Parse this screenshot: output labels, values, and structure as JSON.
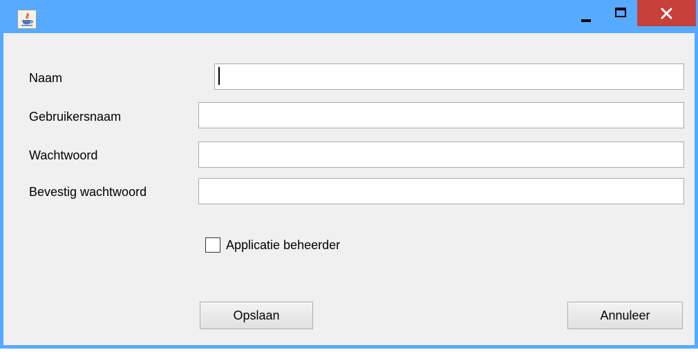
{
  "window": {
    "icon": "java-app-icon",
    "controls": {
      "minimize": "minimize-icon",
      "maximize": "maximize-icon",
      "close": "close-icon"
    },
    "colors": {
      "titlebar": "#56aaff",
      "close_button": "#c7403a",
      "client_background": "#f0f0f0"
    }
  },
  "form": {
    "fields": [
      {
        "label": "Naam",
        "value": "",
        "focused": true
      },
      {
        "label": "Gebruikersnaam",
        "value": ""
      },
      {
        "label": "Wachtwoord",
        "value": ""
      },
      {
        "label": "Bevestig wachtwoord",
        "value": ""
      }
    ],
    "admin_checkbox": {
      "label": "Applicatie beheerder",
      "checked": false
    },
    "save_label": "Opslaan",
    "cancel_label": "Annuleer"
  }
}
